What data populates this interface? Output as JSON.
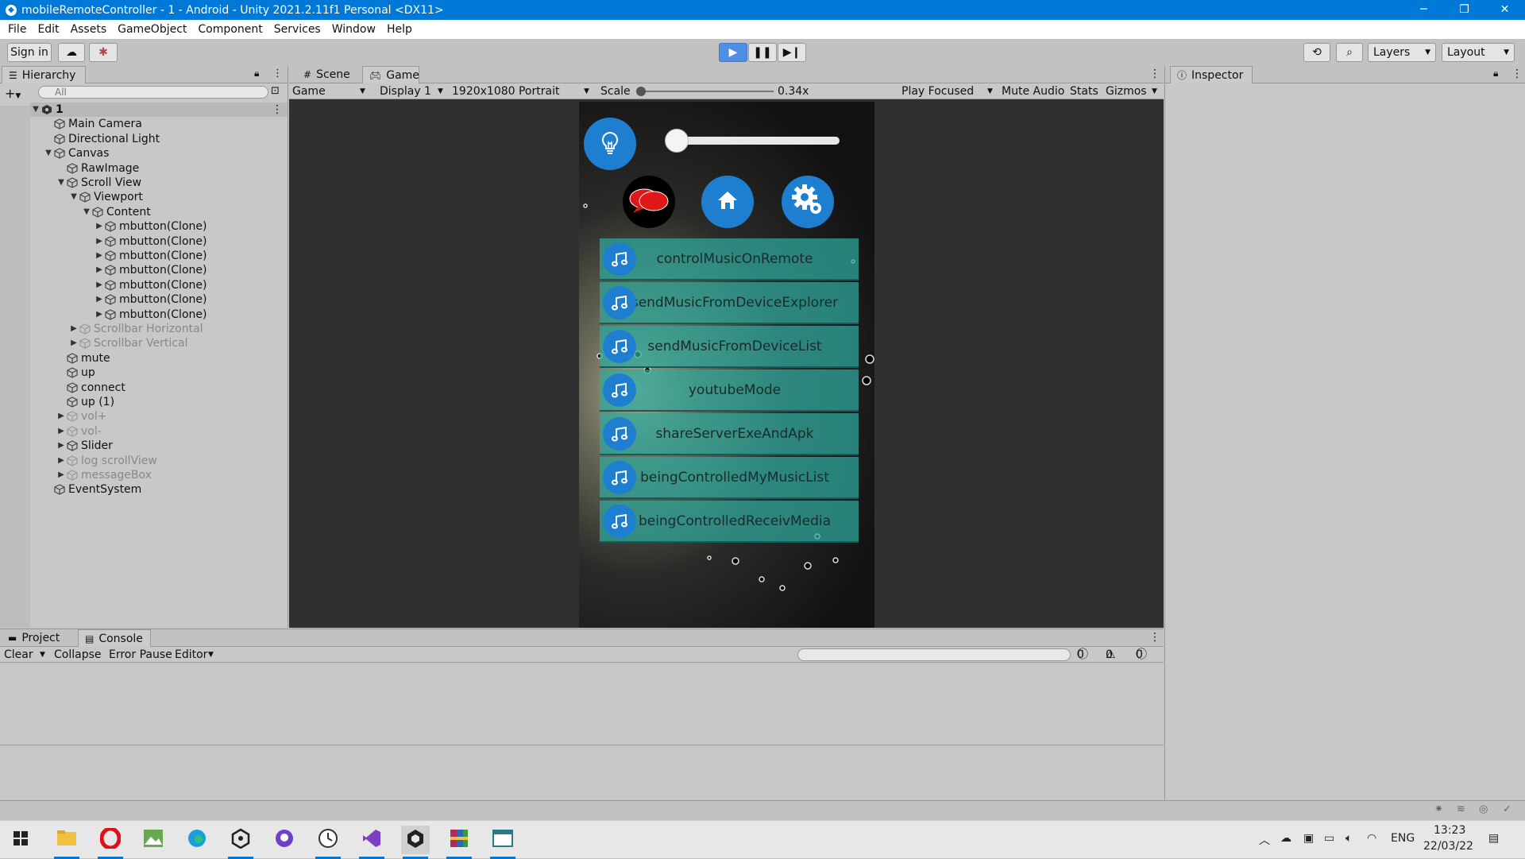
{
  "window": {
    "title": "mobileRemoteController - 1 - Android - Unity 2021.2.11f1 Personal <DX11>",
    "controls": [
      "─",
      "❐",
      "✕"
    ]
  },
  "menu": [
    "File",
    "Edit",
    "Assets",
    "GameObject",
    "Component",
    "Services",
    "Window",
    "Help"
  ],
  "toolbar": {
    "sign_in": "Sign in",
    "layers": "Layers",
    "layout": "Layout"
  },
  "hierarchy": {
    "tab": "Hierarchy",
    "search_placeholder": "All",
    "items": [
      {
        "label": "1",
        "depth": 0,
        "arrow": "▼",
        "bold": true
      },
      {
        "label": "Main Camera",
        "depth": 1,
        "arrow": ""
      },
      {
        "label": "Directional Light",
        "depth": 1,
        "arrow": ""
      },
      {
        "label": "Canvas",
        "depth": 1,
        "arrow": "▼"
      },
      {
        "label": "RawImage",
        "depth": 2,
        "arrow": ""
      },
      {
        "label": "Scroll View",
        "depth": 2,
        "arrow": "▼"
      },
      {
        "label": "Viewport",
        "depth": 3,
        "arrow": "▼"
      },
      {
        "label": "Content",
        "depth": 4,
        "arrow": "▼"
      },
      {
        "label": "mbutton(Clone)",
        "depth": 5,
        "arrow": "▶"
      },
      {
        "label": "mbutton(Clone)",
        "depth": 5,
        "arrow": "▶"
      },
      {
        "label": "mbutton(Clone)",
        "depth": 5,
        "arrow": "▶"
      },
      {
        "label": "mbutton(Clone)",
        "depth": 5,
        "arrow": "▶"
      },
      {
        "label": "mbutton(Clone)",
        "depth": 5,
        "arrow": "▶"
      },
      {
        "label": "mbutton(Clone)",
        "depth": 5,
        "arrow": "▶"
      },
      {
        "label": "mbutton(Clone)",
        "depth": 5,
        "arrow": "▶"
      },
      {
        "label": "Scrollbar Horizontal",
        "depth": 3,
        "arrow": "▶",
        "dim": true
      },
      {
        "label": "Scrollbar Vertical",
        "depth": 3,
        "arrow": "▶",
        "dim": true
      },
      {
        "label": "mute",
        "depth": 2,
        "arrow": ""
      },
      {
        "label": "up",
        "depth": 2,
        "arrow": ""
      },
      {
        "label": "connect",
        "depth": 2,
        "arrow": ""
      },
      {
        "label": "up (1)",
        "depth": 2,
        "arrow": ""
      },
      {
        "label": "vol+",
        "depth": 2,
        "arrow": "▶",
        "dim": true
      },
      {
        "label": "vol-",
        "depth": 2,
        "arrow": "▶",
        "dim": true
      },
      {
        "label": "Slider",
        "depth": 2,
        "arrow": "▶"
      },
      {
        "label": "log scrollView",
        "depth": 2,
        "arrow": "▶",
        "dim": true
      },
      {
        "label": "messageBox",
        "depth": 2,
        "arrow": "▶",
        "dim": true
      },
      {
        "label": "EventSystem",
        "depth": 1,
        "arrow": ""
      }
    ]
  },
  "game_panel": {
    "tabs": [
      "Scene",
      "Game"
    ],
    "dropdown_game": "Game",
    "display": "Display 1",
    "resolution": "1920x1080 Portrait",
    "scale_label": "Scale",
    "scale_value": "0.34x",
    "scale_fraction": 0.02,
    "play_focused": "Play Focused",
    "mute_audio": "Mute Audio",
    "stats": "Stats",
    "gizmos": "Gizmos"
  },
  "app": {
    "slider_fraction": 0.05,
    "buttons": [
      "controlMusicOnRemote",
      "sendMusicFromDeviceExplorer",
      "sendMusicFromDeviceList",
      "youtubeMode",
      "shareServerExeAndApk",
      "beingControlledMyMusicList",
      "beingControlledReceivMedia"
    ],
    "colors": {
      "accent_blue": "#1e7fd0",
      "row_teal": "#2eaa9e",
      "chat_red": "#e01818"
    }
  },
  "inspector": {
    "tab": "Inspector"
  },
  "console": {
    "tabs": [
      "Project",
      "Console"
    ],
    "clear": "Clear",
    "collapse": "Collapse",
    "error_pause": "Error Pause",
    "editor": "Editor",
    "counts": [
      "0",
      "0",
      "0"
    ]
  },
  "taskbar": {
    "lang": "ENG",
    "time": "13:23",
    "date": "22/03/22"
  }
}
